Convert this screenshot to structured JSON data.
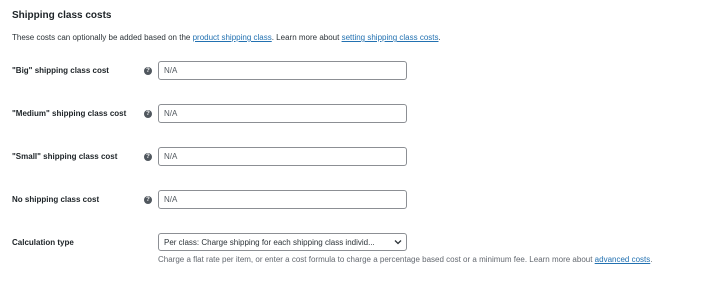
{
  "section": {
    "title": "Shipping class costs",
    "description_before": "These costs can optionally be added based on the ",
    "link_product_class": "product shipping class",
    "description_middle": ". Learn more about ",
    "link_setting_class": "setting shipping class costs",
    "description_after": "."
  },
  "rows": [
    {
      "label": "\"Big\" shipping class cost",
      "help_icon": "question-circle",
      "placeholder": "N/A"
    },
    {
      "label": "\"Medium\" shipping class cost",
      "help_icon": "question-circle",
      "placeholder": "N/A"
    },
    {
      "label": "\"Small\" shipping class cost",
      "help_icon": "question-circle",
      "placeholder": "N/A"
    },
    {
      "label": "No shipping class cost",
      "help_icon": "question-circle",
      "placeholder": "N/A"
    }
  ],
  "calculation": {
    "label": "Calculation type",
    "selected": "Per class: Charge shipping for each shipping class individ...",
    "description": "Charge a flat rate per item, or enter a cost formula to charge a percentage based cost or a minimum fee. Learn more about ",
    "link": "advanced costs",
    "description_after": "."
  },
  "colors": {
    "link": "#2271b1",
    "text": "#1d2327",
    "border": "#8c8f94"
  }
}
